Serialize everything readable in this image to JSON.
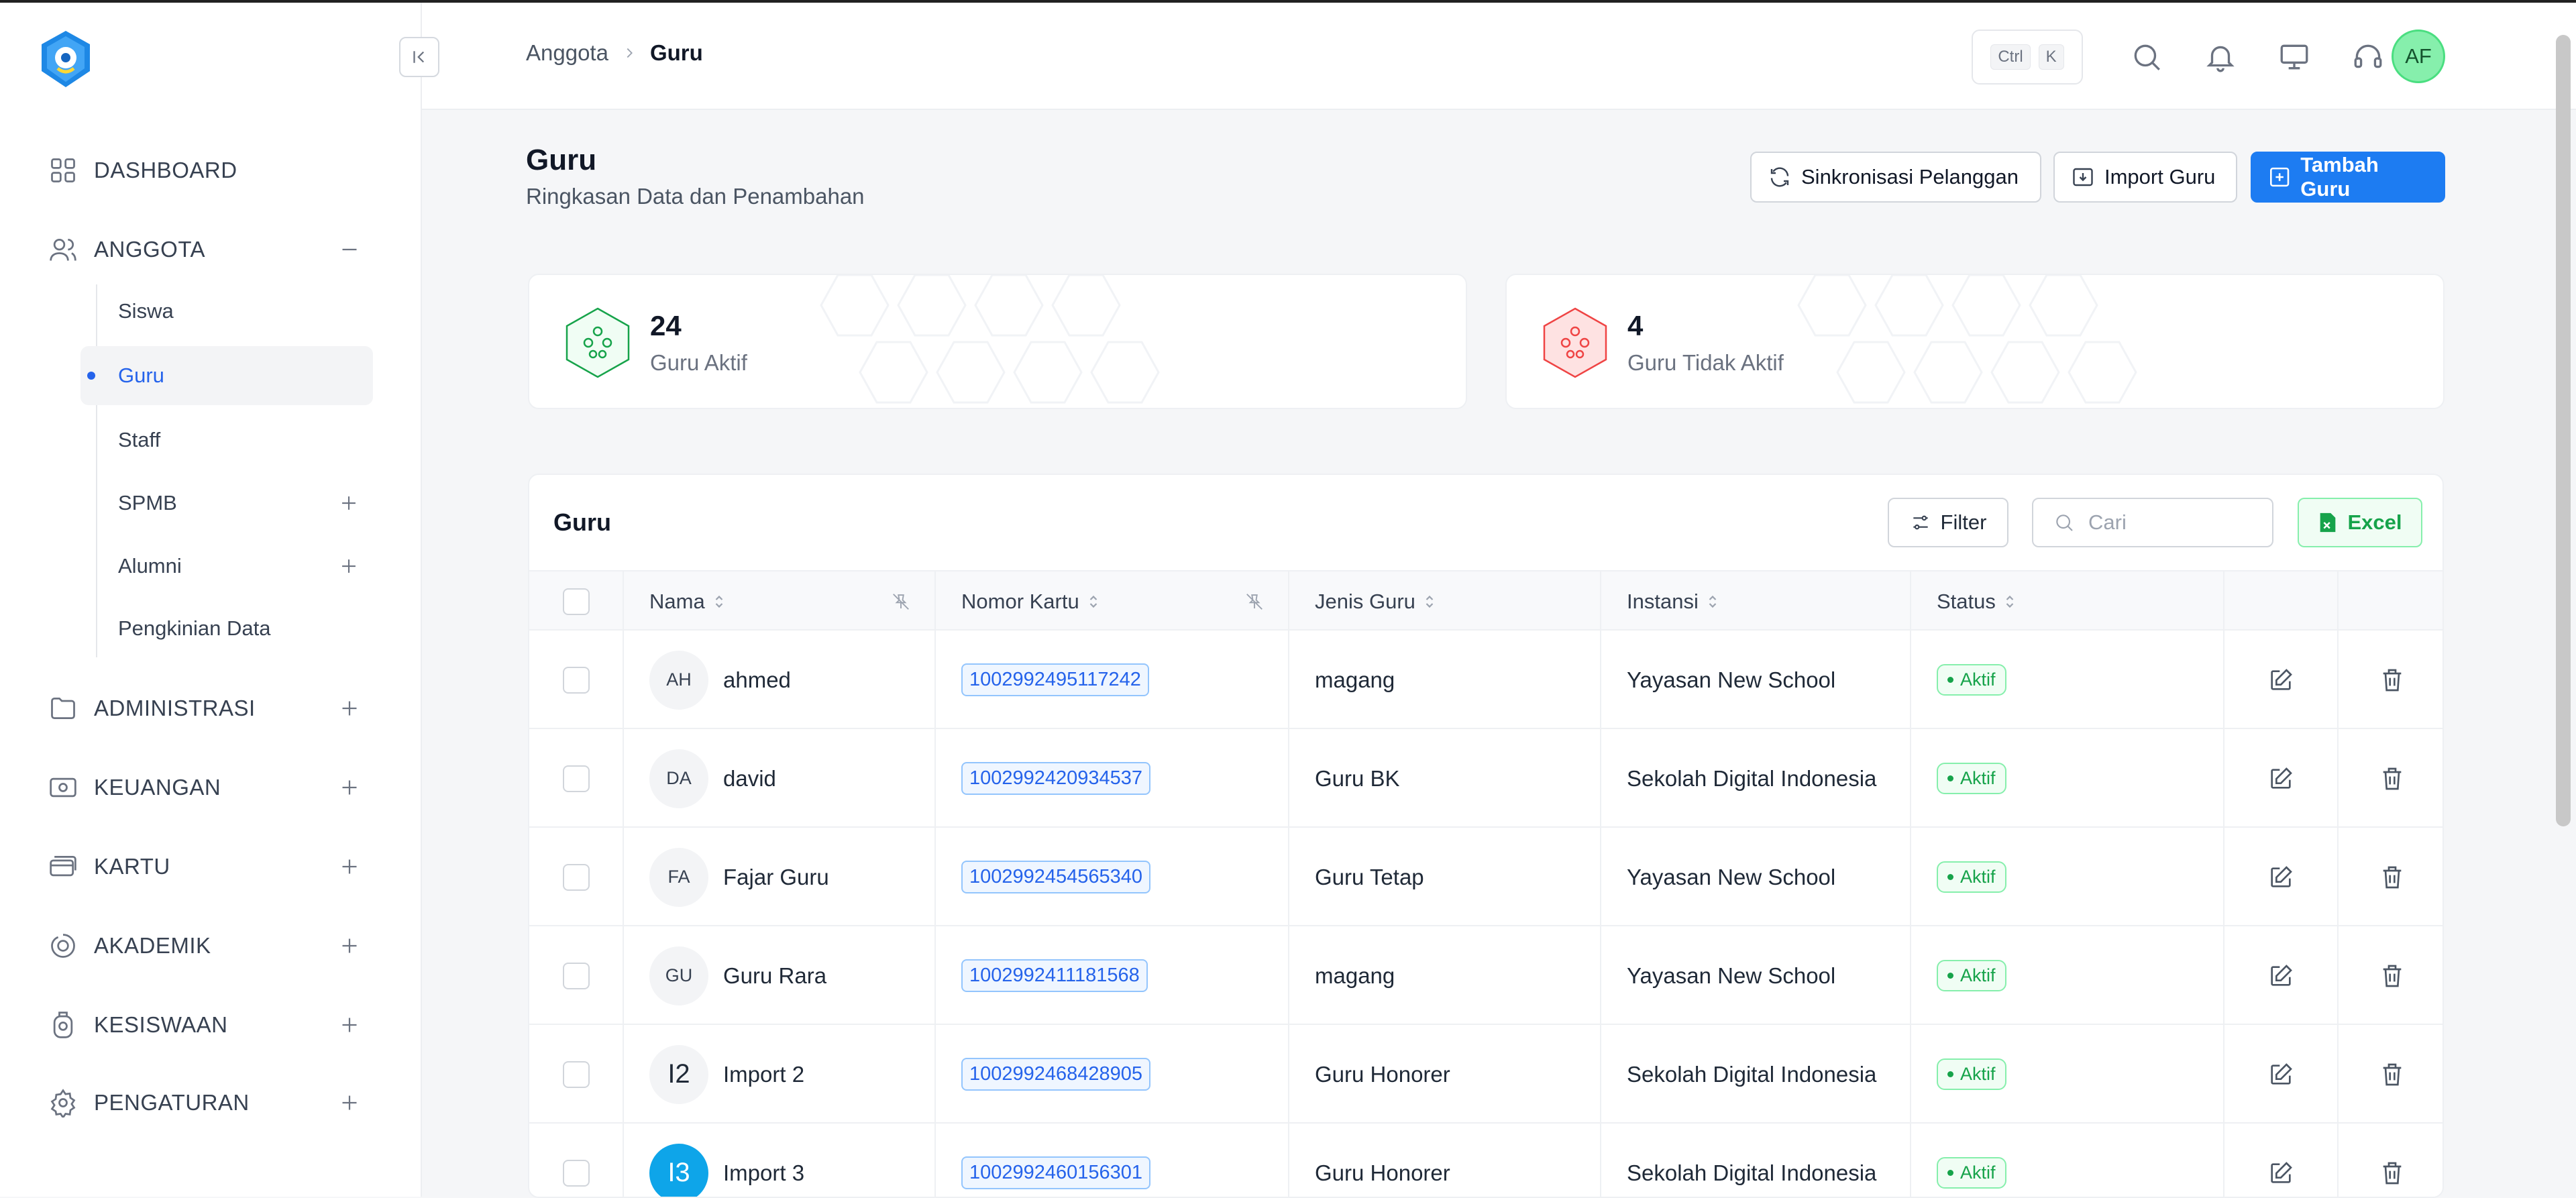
{
  "sidebar": {
    "items": [
      {
        "label": "DASHBOARD",
        "icon": "grid-icon"
      },
      {
        "label": "ANGGOTA",
        "icon": "users-icon",
        "expanded": true
      },
      {
        "label": "ADMINISTRASI",
        "icon": "folder-icon"
      },
      {
        "label": "KEUANGAN",
        "icon": "cash-icon"
      },
      {
        "label": "KARTU",
        "icon": "card-icon"
      },
      {
        "label": "AKADEMIK",
        "icon": "academic-icon"
      },
      {
        "label": "KESISWAAN",
        "icon": "student-icon"
      },
      {
        "label": "PENGATURAN",
        "icon": "gear-icon"
      }
    ],
    "sub_items": [
      {
        "label": "Siswa"
      },
      {
        "label": "Guru",
        "active": true
      },
      {
        "label": "Staff"
      },
      {
        "label": "SPMB",
        "expandable": true
      },
      {
        "label": "Alumni",
        "expandable": true
      },
      {
        "label": "Pengkinian Data"
      }
    ]
  },
  "header": {
    "breadcrumb": [
      "Anggota",
      "Guru"
    ],
    "shortcut": [
      "Ctrl",
      "K"
    ],
    "avatar_initials": "AF"
  },
  "page": {
    "title": "Guru",
    "subtitle": "Ringkasan Data dan Penambahan",
    "buttons": {
      "sync": "Sinkronisasi Pelanggan",
      "import": "Import Guru",
      "add": "Tambah Guru"
    }
  },
  "stats": [
    {
      "value": "24",
      "label": "Guru Aktif",
      "color": "#16a34a"
    },
    {
      "value": "4",
      "label": "Guru Tidak Aktif",
      "color": "#ef4444"
    }
  ],
  "table": {
    "title": "Guru",
    "filter_label": "Filter",
    "search_placeholder": "Cari",
    "excel_label": "Excel",
    "columns": [
      "Nama",
      "Nomor Kartu",
      "Jenis Guru",
      "Instansi",
      "Status"
    ],
    "rows": [
      {
        "initials": "AH",
        "name": "ahmed",
        "card": "1002992495117242",
        "type": "magang",
        "institution": "Yayasan New School",
        "status": "Aktif"
      },
      {
        "initials": "DA",
        "name": "david",
        "card": "1002992420934537",
        "type": "Guru BK",
        "institution": "Sekolah Digital Indonesia",
        "status": "Aktif"
      },
      {
        "initials": "FA",
        "name": "Fajar Guru",
        "card": "1002992454565340",
        "type": "Guru Tetap",
        "institution": "Yayasan New School",
        "status": "Aktif"
      },
      {
        "initials": "GU",
        "name": "Guru Rara",
        "card": "1002992411181568",
        "type": "magang",
        "institution": "Yayasan New School",
        "status": "Aktif"
      },
      {
        "initials": "I2",
        "name": "Import 2",
        "card": "1002992468428905",
        "type": "Guru Honorer",
        "institution": "Sekolah Digital Indonesia",
        "status": "Aktif"
      },
      {
        "initials": "I3",
        "name": "Import 3",
        "card": "1002992460156301",
        "type": "Guru Honorer",
        "institution": "Sekolah Digital Indonesia",
        "status": "Aktif"
      }
    ]
  },
  "colors": {
    "accent": "#1d7cf2",
    "active_green": "#16a34a",
    "inactive_red": "#ef4444"
  }
}
